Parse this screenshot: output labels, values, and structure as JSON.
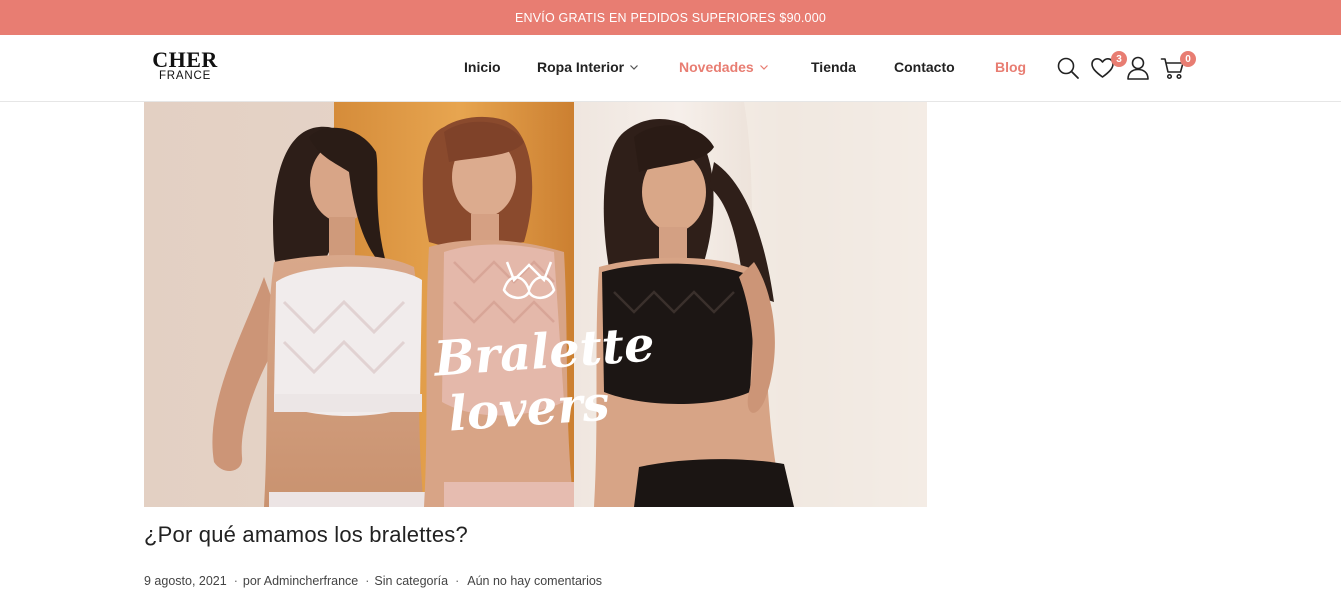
{
  "promo": {
    "text": "ENVÍO GRATIS EN PEDIDOS SUPERIORES $90.000"
  },
  "logo": {
    "main": "CHER",
    "sub": "FRANCE"
  },
  "nav": {
    "items": [
      {
        "label": "Inicio",
        "dropdown": false,
        "accent": false
      },
      {
        "label": "Ropa Interior",
        "dropdown": true,
        "accent": false
      },
      {
        "label": "Novedades",
        "dropdown": true,
        "accent": true
      },
      {
        "label": "Tienda",
        "dropdown": false,
        "accent": false
      },
      {
        "label": "Contacto",
        "dropdown": false,
        "accent": false
      },
      {
        "label": "Blog",
        "dropdown": false,
        "accent": true
      }
    ]
  },
  "header_icons": {
    "search": "search-icon",
    "wishlist": "heart-icon",
    "wishlist_count": "3",
    "account": "user-icon",
    "cart": "cart-icon",
    "cart_count": "0"
  },
  "hero": {
    "overlay_line1": "Bralette",
    "overlay_line2": "lovers"
  },
  "post": {
    "title": "¿Por qué amamos los bralettes?",
    "date": "9 agosto, 2021",
    "author": "por Admincherfrance",
    "category": "Sin categoría",
    "comments": "Aún no hay comentarios"
  },
  "colors": {
    "accent": "#e87d72",
    "text": "#222222"
  }
}
